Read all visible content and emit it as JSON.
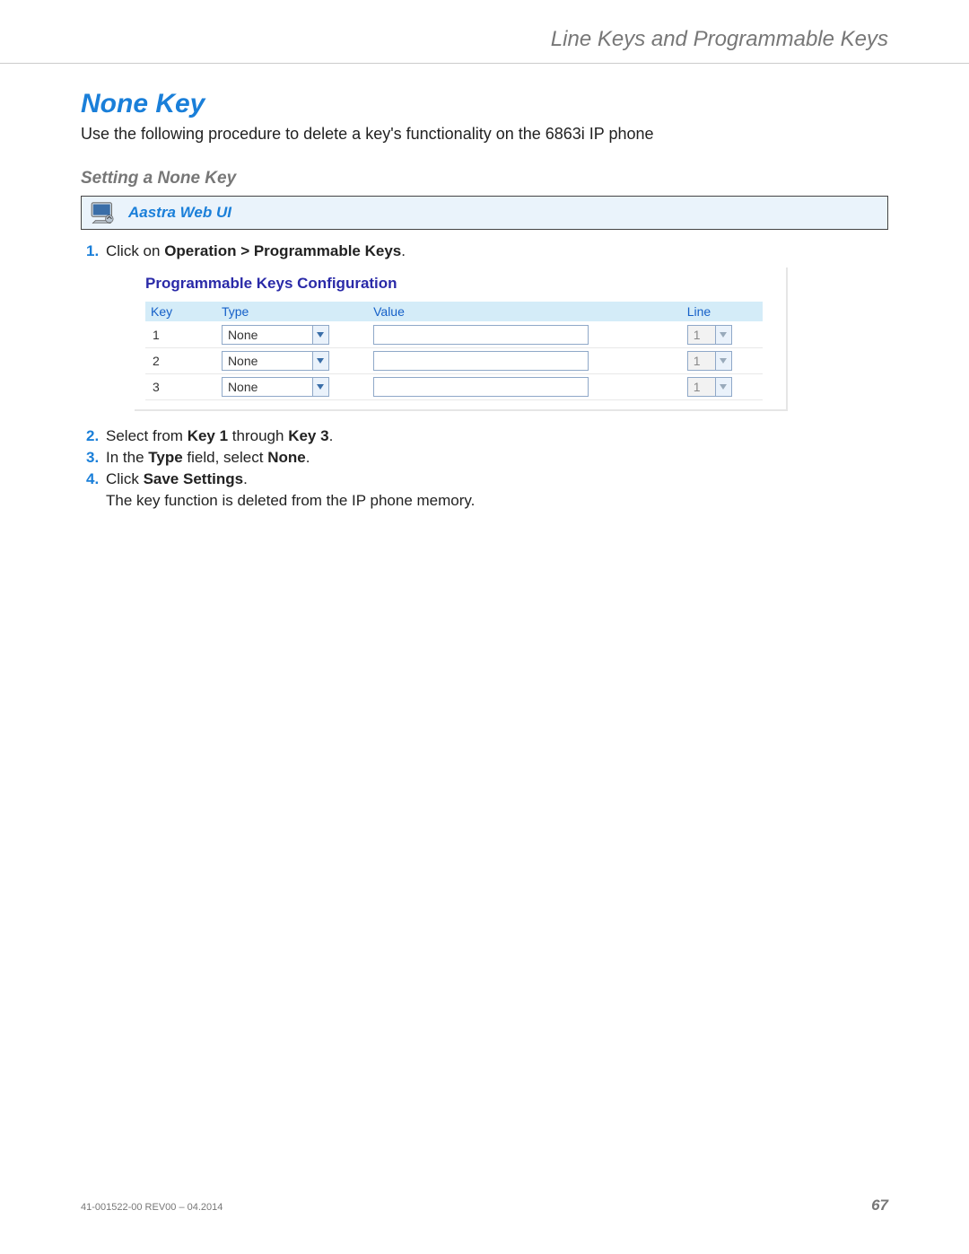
{
  "header": {
    "breadcrumb": "Line Keys and Programmable Keys"
  },
  "section": {
    "title": "None Key",
    "intro": "Use the following procedure to delete a key's functionality on the 6863i IP phone",
    "subtitle": "Setting a None Key"
  },
  "uibox": {
    "label": "Aastra Web UI"
  },
  "steps": {
    "s1_num": "1.",
    "s1_a": "Click on ",
    "s1_b": "Operation > Programmable Keys",
    "s1_c": ".",
    "s2_num": "2.",
    "s2_a": "Select from ",
    "s2_b": "Key 1",
    "s2_c": " through ",
    "s2_d": "Key 3",
    "s2_e": ".",
    "s3_num": "3.",
    "s3_a": "In the ",
    "s3_b": "Type",
    "s3_c": " field, select ",
    "s3_d": "None",
    "s3_e": ".",
    "s4_num": "4.",
    "s4_a": "Click ",
    "s4_b": "Save Settings",
    "s4_c": ".",
    "s4_sub": "The key function is deleted from the IP phone memory."
  },
  "config": {
    "title": "Programmable Keys Configuration",
    "headers": {
      "key": "Key",
      "type": "Type",
      "value": "Value",
      "line": "Line"
    },
    "rows": [
      {
        "key": "1",
        "type": "None",
        "value": "",
        "line": "1"
      },
      {
        "key": "2",
        "type": "None",
        "value": "",
        "line": "1"
      },
      {
        "key": "3",
        "type": "None",
        "value": "",
        "line": "1"
      }
    ]
  },
  "footer": {
    "doc": "41-001522-00 REV00 – 04.2014",
    "page": "67"
  }
}
